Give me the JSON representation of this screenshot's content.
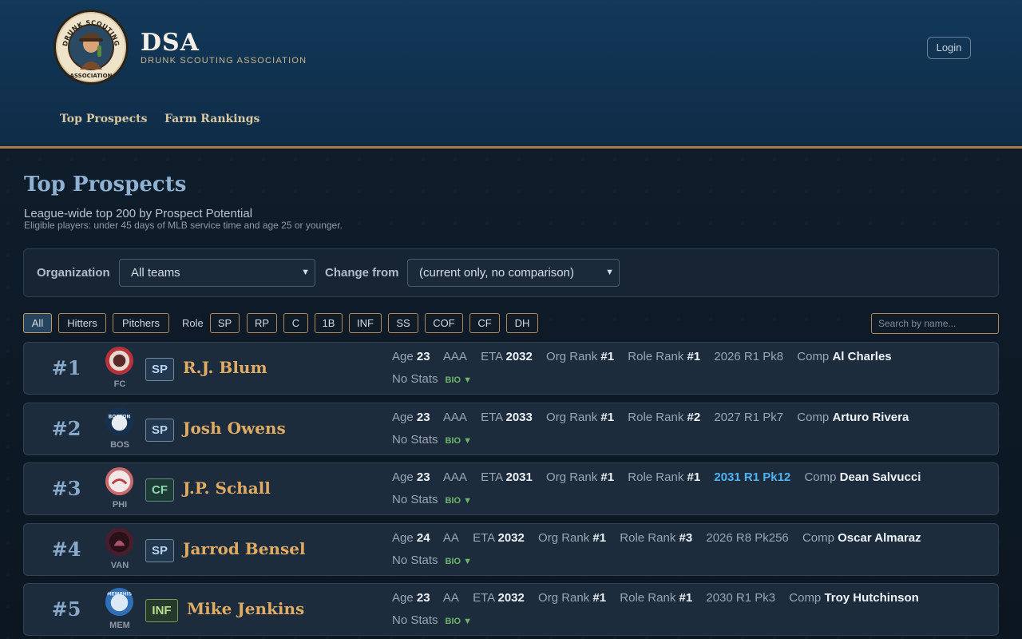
{
  "brand": {
    "title": "DSA",
    "subtitle": "DRUNK SCOUTING ASSOCIATION",
    "logo_text": "DRUNK SCOUTING ASSOCIATION"
  },
  "header": {
    "login_label": "Login"
  },
  "nav": [
    {
      "label": "Top Prospects"
    },
    {
      "label": "Farm Rankings"
    }
  ],
  "page": {
    "title": "Top Prospects",
    "subtitle": "League-wide top 200 by Prospect Potential",
    "note": "Eligible players: under 45 days of MLB service time and age 25 or younger."
  },
  "filters": {
    "organization_label": "Organization",
    "organization_value": "All teams",
    "change_label": "Change from",
    "change_value": "(current only, no comparison)"
  },
  "chips": {
    "groups": [
      "All",
      "Hitters",
      "Pitchers"
    ],
    "role_label": "Role",
    "roles": [
      "SP",
      "RP",
      "C",
      "1B",
      "INF",
      "SS",
      "COF",
      "CF",
      "DH"
    ],
    "active": "All"
  },
  "search": {
    "placeholder": "Search by name..."
  },
  "labels": {
    "age": "Age",
    "eta": "ETA",
    "org_rank": "Org Rank",
    "role_rank": "Role Rank",
    "comp": "Comp",
    "bio": "BIO ▼"
  },
  "prospects": [
    {
      "rank": "#1",
      "team": "FC",
      "pos": "SP",
      "name": "R.J. Blum",
      "age": "23",
      "level": "AAA",
      "eta": "2032",
      "org_rank": "#1",
      "role_rank": "#1",
      "draft": "2026 R1 Pk8",
      "draft_link": false,
      "comp": "Al Charles",
      "stats": "No Stats",
      "team_color": "#b8323a"
    },
    {
      "rank": "#2",
      "team": "BOS",
      "pos": "SP",
      "name": "Josh Owens",
      "age": "23",
      "level": "AAA",
      "eta": "2033",
      "org_rank": "#1",
      "role_rank": "#2",
      "draft": "2027 R1 Pk7",
      "draft_link": false,
      "comp": "Arturo Rivera",
      "stats": "No Stats",
      "team_color": "#1d3f66"
    },
    {
      "rank": "#3",
      "team": "PHI",
      "pos": "CF",
      "name": "J.P. Schall",
      "age": "23",
      "level": "AAA",
      "eta": "2031",
      "org_rank": "#1",
      "role_rank": "#1",
      "draft": "2031 R1 Pk12",
      "draft_link": true,
      "comp": "Dean Salvucci",
      "stats": "No Stats",
      "team_color": "#c96a6f"
    },
    {
      "rank": "#4",
      "team": "VAN",
      "pos": "SP",
      "name": "Jarrod Bensel",
      "age": "24",
      "level": "AA",
      "eta": "2032",
      "org_rank": "#1",
      "role_rank": "#3",
      "draft": "2026 R8 Pk256",
      "draft_link": false,
      "comp": "Oscar Almaraz",
      "stats": "No Stats",
      "team_color": "#4a1d2c"
    },
    {
      "rank": "#5",
      "team": "MEM",
      "pos": "INF",
      "name": "Mike Jenkins",
      "age": "23",
      "level": "AA",
      "eta": "2032",
      "org_rank": "#1",
      "role_rank": "#1",
      "draft": "2030 R1 Pk3",
      "draft_link": false,
      "comp": "Troy Hutchinson",
      "stats": "No Stats",
      "team_color": "#2f6fb6"
    }
  ]
}
